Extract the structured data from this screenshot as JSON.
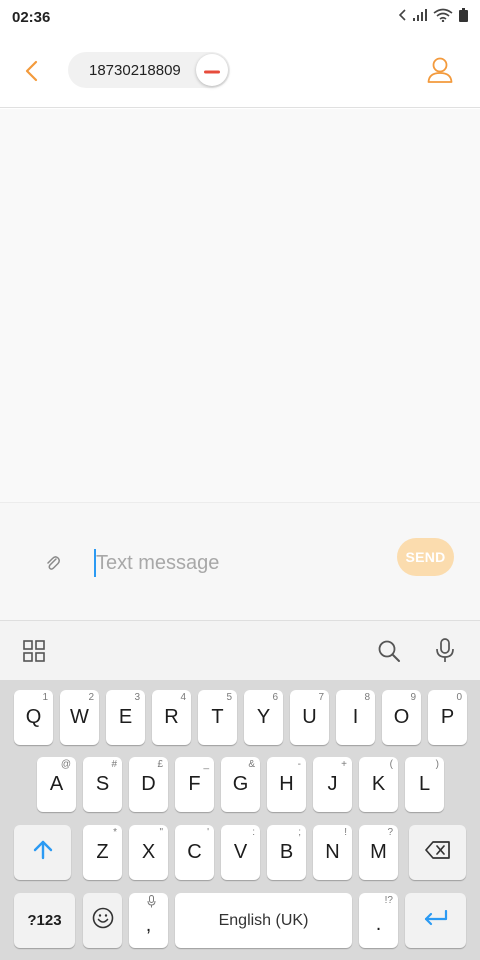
{
  "status_bar": {
    "time": "02:36",
    "icons": [
      "chevron-left-icon",
      "signal-icon",
      "wifi-icon",
      "battery-icon"
    ]
  },
  "header": {
    "back_icon": "back-arrow-icon",
    "recipient_number": "18730218809",
    "remove_icon": "minus-icon",
    "contact_icon": "contact-person-icon"
  },
  "compose": {
    "attach_icon": "paperclip-icon",
    "placeholder": "Text message",
    "send_label": "SEND"
  },
  "keyboard_toolbar": {
    "icons": [
      "apps-grid-icon",
      "search-icon",
      "microphone-icon"
    ]
  },
  "keyboard": {
    "row1": [
      {
        "key": "Q",
        "hint": "1"
      },
      {
        "key": "W",
        "hint": "2"
      },
      {
        "key": "E",
        "hint": "3"
      },
      {
        "key": "R",
        "hint": "4"
      },
      {
        "key": "T",
        "hint": "5"
      },
      {
        "key": "Y",
        "hint": "6"
      },
      {
        "key": "U",
        "hint": "7"
      },
      {
        "key": "I",
        "hint": "8"
      },
      {
        "key": "O",
        "hint": "9"
      },
      {
        "key": "P",
        "hint": "0"
      }
    ],
    "row2": [
      {
        "key": "A",
        "hint": "@"
      },
      {
        "key": "S",
        "hint": "#"
      },
      {
        "key": "D",
        "hint": "£"
      },
      {
        "key": "F",
        "hint": "_"
      },
      {
        "key": "G",
        "hint": "&"
      },
      {
        "key": "H",
        "hint": "-"
      },
      {
        "key": "J",
        "hint": "+"
      },
      {
        "key": "K",
        "hint": "("
      },
      {
        "key": "L",
        "hint": ")"
      }
    ],
    "row3": [
      {
        "key": "Z",
        "hint": "*"
      },
      {
        "key": "X",
        "hint": "\""
      },
      {
        "key": "C",
        "hint": "'"
      },
      {
        "key": "V",
        "hint": ":"
      },
      {
        "key": "B",
        "hint": ";"
      },
      {
        "key": "N",
        "hint": "!"
      },
      {
        "key": "M",
        "hint": "?"
      }
    ],
    "shift_icon": "shift-arrow-icon",
    "backspace_icon": "backspace-icon",
    "symbols_label": "?123",
    "emoji_icon": "emoji-icon",
    "comma_label": ",",
    "space_label": "English (UK)",
    "period_label": ".",
    "period_hint": "!?",
    "enter_icon": "enter-icon"
  },
  "colors": {
    "accent": "#f39a3c",
    "send_disabled": "#fbdcae",
    "remove_red": "#e74c3c",
    "cursor_blue": "#2b9af3",
    "enter_blue": "#2b9af3"
  }
}
